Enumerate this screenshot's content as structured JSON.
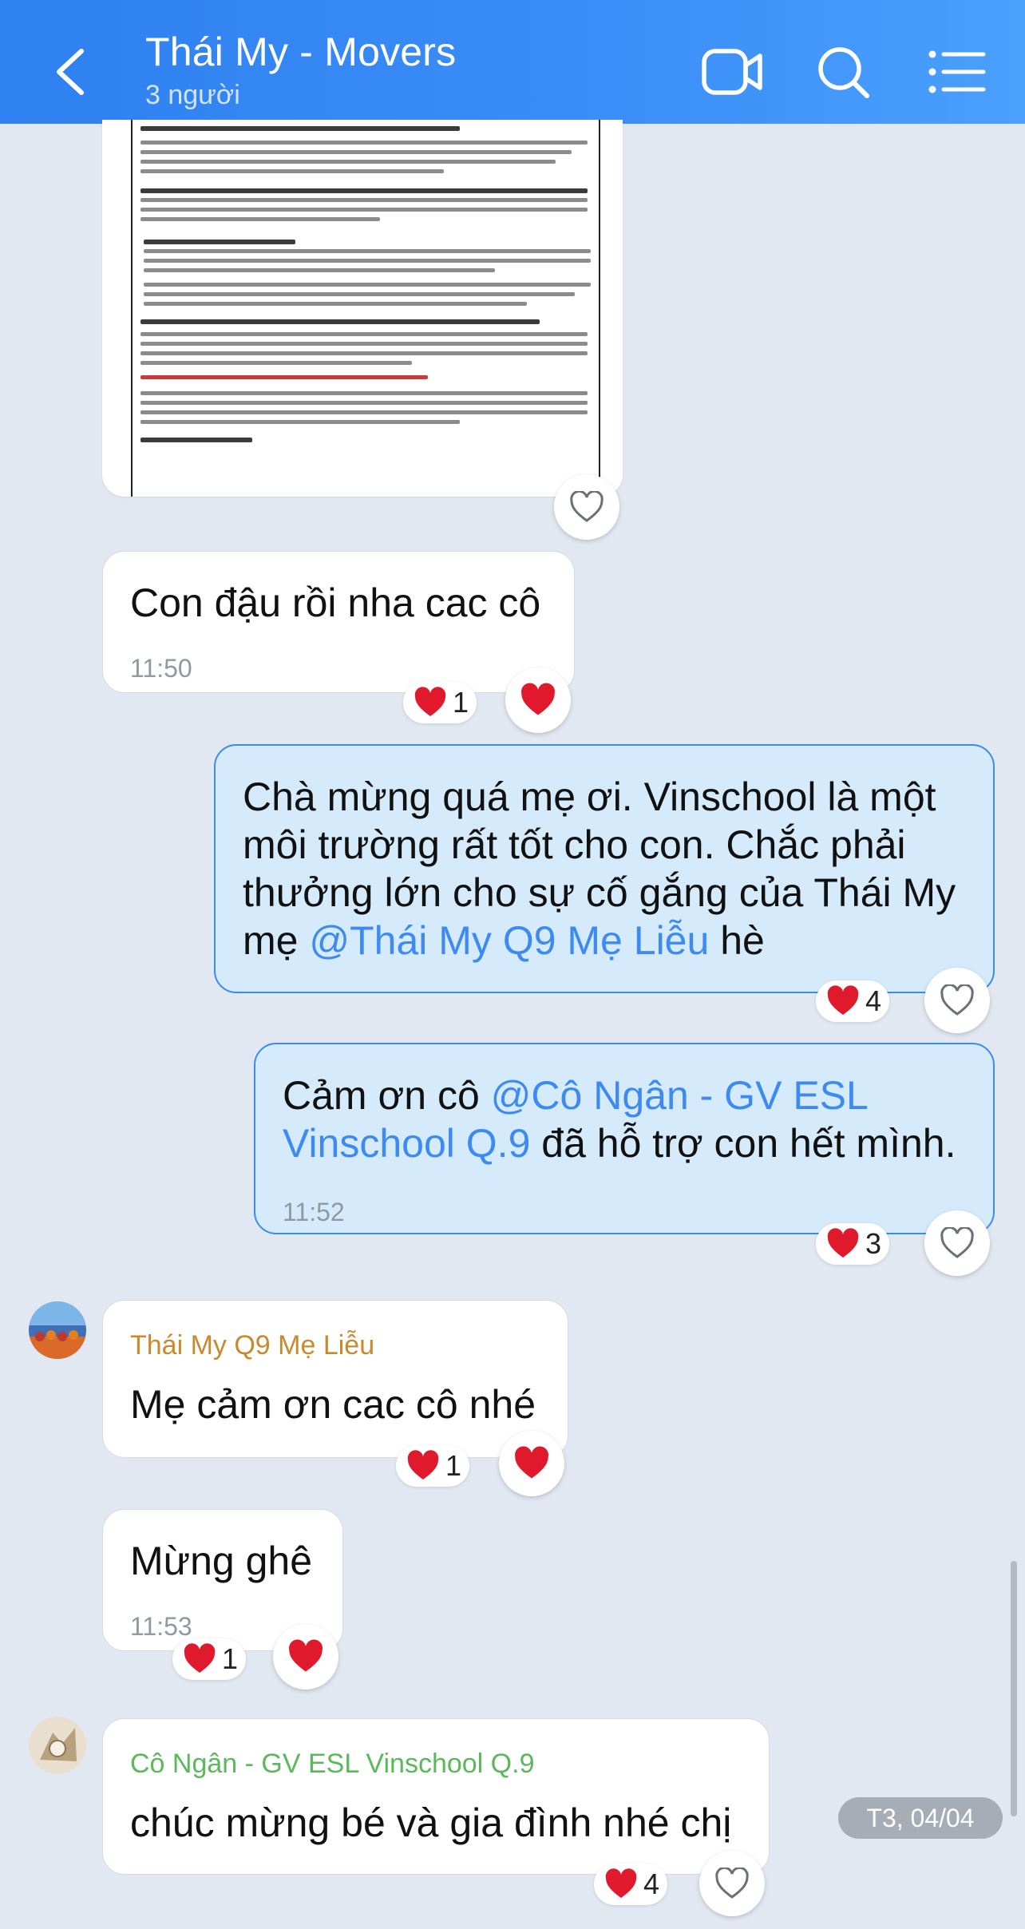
{
  "header": {
    "title": "Thái My - Movers",
    "subtitle": "3 người",
    "icons": [
      "back-icon",
      "video-call-icon",
      "search-icon",
      "menu-list-icon"
    ]
  },
  "document_preview": {
    "visible": true
  },
  "messages": [
    {
      "id": "m1",
      "direction": "in",
      "text": "Con đậu rồi nha cac cô",
      "time": "11:50",
      "reaction_count": "1"
    },
    {
      "id": "m2",
      "direction": "out",
      "lines": [
        "Chà mừng quá mẹ ơi. Vinschool là một",
        "môi trường rất tốt cho con. Chắc phải",
        "thưởng lớn cho sự cố gắng của Thái My"
      ],
      "line4_prefix": "mẹ ",
      "mention": "@Thái My Q9 Mẹ Liễu",
      "line4_suffix": " hè",
      "reaction_count": "4"
    },
    {
      "id": "m3",
      "direction": "out",
      "prefix": "Cảm ơn cô ",
      "mention_line1": "@Cô Ngân -  GV ESL",
      "mention_line2": "Vinschool Q.9",
      "suffix": " đã hỗ trợ con hết mình.",
      "time": "11:52",
      "reaction_count": "3"
    },
    {
      "id": "m4",
      "direction": "in",
      "sender": "Thái My Q9 Mẹ Liễu",
      "text": "Mẹ cảm ơn cac cô nhé",
      "reaction_count": "1"
    },
    {
      "id": "m5",
      "direction": "in",
      "text": "Mừng ghê",
      "time": "11:53",
      "reaction_count": "1"
    },
    {
      "id": "m6",
      "direction": "in",
      "sender": "Cô Ngân -  GV ESL Vinschool Q.9",
      "text": "chúc mừng bé và gia đình nhé chị",
      "reaction_count": "4"
    }
  ],
  "date_chip": "T3, 04/04",
  "colors": {
    "header": "#3b8ef7",
    "background": "#e2e8f1",
    "outgoing_bubble": "#d5ebfc",
    "outgoing_border": "#3a8cf2",
    "mention": "#3d8af2",
    "sender_1": "#c98a2e",
    "sender_2": "#5cb85c",
    "heart": "#e0192c"
  }
}
